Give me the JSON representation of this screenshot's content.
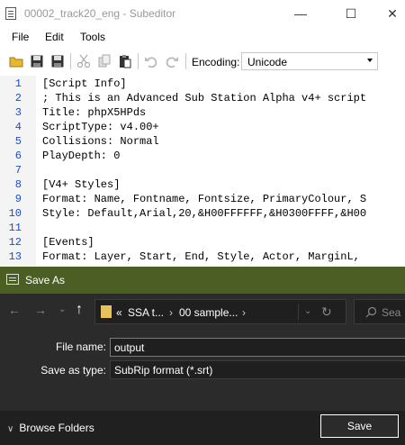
{
  "window": {
    "title": "00002_track20_eng - Subeditor",
    "minimize": "—",
    "maximize": "☐",
    "close": "✕"
  },
  "menu": [
    "File",
    "Edit",
    "Tools"
  ],
  "toolbar": {
    "encoding_label": "Encoding:",
    "encoding_value": "Unicode"
  },
  "editor": {
    "line_numbers": [
      "1",
      "2",
      "3",
      "4",
      "5",
      "6",
      "7",
      "8",
      "9",
      "10",
      "11",
      "12",
      "13"
    ],
    "lines": [
      "[Script Info]",
      "; This is an Advanced Sub Station Alpha v4+ script",
      "Title: phpX5HPds",
      "ScriptType: v4.00+",
      "Collisions: Normal",
      "PlayDepth: 0",
      "",
      "[V4+ Styles]",
      "Format: Name, Fontname, Fontsize, PrimaryColour, S",
      "Style: Default,Arial,20,&H00FFFFFF,&H0300FFFF,&H00",
      "",
      "[Events]",
      "Format: Layer, Start, End, Style, Actor, MarginL,"
    ]
  },
  "dialog": {
    "title": "Save As",
    "breadcrumb": [
      "«",
      "SSA t...",
      "›",
      "00 sample...",
      "›"
    ],
    "search_placeholder": "Sea",
    "filename_label": "File name:",
    "filename_value": "output",
    "savetype_label": "Save as type:",
    "savetype_value": "SubRip format (*.srt)",
    "browse_folders": "Browse Folders",
    "save_label": "Save"
  },
  "colors": {
    "dialog_titlebar": "#4b5f24",
    "line_number": "#1c4fc4",
    "folder": "#e8c15b"
  }
}
